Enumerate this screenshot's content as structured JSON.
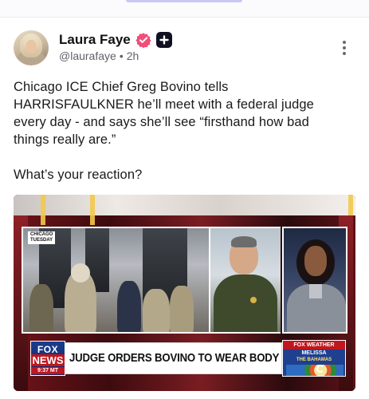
{
  "post": {
    "author": {
      "name": "Laura Faye",
      "handle": "@laurafaye",
      "time": "2h",
      "separator": "•"
    },
    "text_lines": [
      "Chicago ICE Chief Greg Bovino tells",
      "HARRISFAULKNER he’ll meet with a federal judge",
      "every day - and says she’ll see “firsthand how bad",
      "things really are.”"
    ],
    "question": "What’s your reaction?"
  },
  "media": {
    "location_chip_line1": "CHICAGO",
    "location_chip_line2": "TUESDAY",
    "network_word1": "FOX",
    "network_word2": "NEWS",
    "clock": "9:37 MT",
    "headline": "JUDGE ORDERS BOVINO TO WEAR BODY CAM",
    "weather_title": "FOX WEATHER",
    "weather_storm": "MELISSA",
    "weather_sub": "THE BAHAMAS"
  },
  "colors": {
    "verified": "#f04e77",
    "plus_badge": "#0f1020",
    "fox_blue": "#0b2566",
    "fox_red": "#c0161d"
  },
  "icons": {
    "verified": "verified-badge-icon",
    "plus": "plus-badge-icon",
    "more": "more-vertical-icon"
  }
}
